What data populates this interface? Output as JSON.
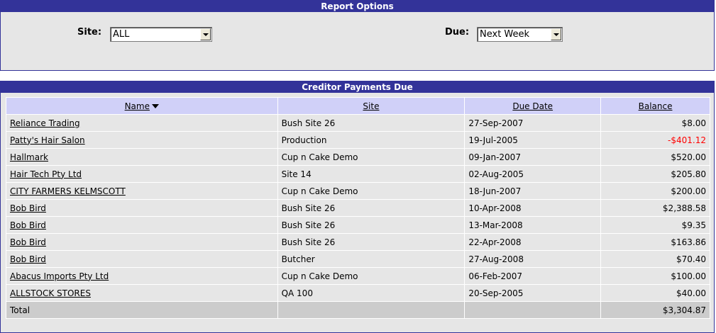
{
  "options": {
    "title": "Report Options",
    "site_label": "Site:",
    "site_value": "ALL",
    "due_label": "Due:",
    "due_value": "Next Week"
  },
  "payments": {
    "title": "Creditor Payments Due",
    "columns": [
      "Name",
      "Site",
      "Due Date",
      "Balance"
    ],
    "rows": [
      {
        "name": "Reliance Trading",
        "site": "Bush Site 26",
        "due": "27-Sep-2007",
        "balance": "$8.00"
      },
      {
        "name": "Patty's Hair Salon",
        "site": "Production",
        "due": "19-Jul-2005",
        "balance": "-$401.12"
      },
      {
        "name": "Hallmark",
        "site": "Cup n Cake Demo",
        "due": "09-Jan-2007",
        "balance": "$520.00"
      },
      {
        "name": "Hair Tech Pty Ltd",
        "site": "Site 14",
        "due": "02-Aug-2005",
        "balance": "$205.80"
      },
      {
        "name": "CITY FARMERS KELMSCOTT",
        "site": "Cup n Cake Demo",
        "due": "18-Jun-2007",
        "balance": "$200.00"
      },
      {
        "name": "Bob Bird",
        "site": "Bush Site 26",
        "due": "10-Apr-2008",
        "balance": "$2,388.58"
      },
      {
        "name": "Bob Bird",
        "site": "Bush Site 26",
        "due": "13-Mar-2008",
        "balance": "$9.35"
      },
      {
        "name": "Bob Bird",
        "site": "Bush Site 26",
        "due": "22-Apr-2008",
        "balance": "$163.86"
      },
      {
        "name": "Bob Bird",
        "site": "Butcher",
        "due": "27-Aug-2008",
        "balance": "$70.40"
      },
      {
        "name": "Abacus Imports Pty Ltd",
        "site": "Cup n Cake Demo",
        "due": "06-Feb-2007",
        "balance": "$100.00"
      },
      {
        "name": "ALLSTOCK STORES",
        "site": "QA 100",
        "due": "20-Sep-2005",
        "balance": "$40.00"
      }
    ],
    "total_label": "Total",
    "total_value": "$3,304.87",
    "negative_color": "#ff0000"
  },
  "colors": {
    "header_bg": "#333399",
    "column_header_bg": "#d0d0f8",
    "row_bg": "#e6e6e6",
    "total_bg": "#cccccc"
  }
}
